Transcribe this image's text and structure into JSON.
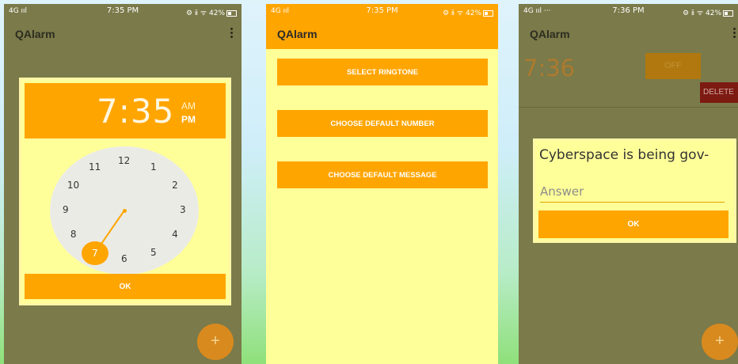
{
  "screens": [
    {
      "status": {
        "left": "4G ııl",
        "time": "7:35 PM",
        "right": "⚙ ⅱ ᯤ 42%"
      },
      "app_title": "QAlarm",
      "time_picker": {
        "time": "7:35",
        "am": "AM",
        "pm": "PM",
        "hours": [
          "12",
          "1",
          "2",
          "3",
          "4",
          "5",
          "6",
          "7",
          "8",
          "9",
          "10",
          "11"
        ],
        "selected_hour": "7",
        "ok": "OK"
      },
      "fab": "+"
    },
    {
      "status": {
        "left": "4G ııl",
        "time": "7:35 PM",
        "right": "⚙ ⅱ ᯤ 42%"
      },
      "app_title": "QAlarm",
      "buttons": [
        "SELECT RINGTONE",
        "CHOOSE DEFAULT NUMBER",
        "CHOOSE DEFAULT MESSAGE"
      ]
    },
    {
      "status": {
        "left": "4G ııl ···",
        "time": "7:36 PM",
        "right": "⚙ ⅱ ᯤ 42%"
      },
      "app_title": "QAlarm",
      "alarm": {
        "time": "7:36",
        "toggle": "OFF",
        "delete": "DELETE"
      },
      "question_dialog": {
        "question": "Cyberspace is being gov-",
        "answer_placeholder": "Answer",
        "ok": "OK"
      },
      "fab": "+"
    }
  ],
  "colors": {
    "accent": "#ffa500",
    "panel": "#ffff99",
    "dim_background": "#7a7a4a"
  }
}
